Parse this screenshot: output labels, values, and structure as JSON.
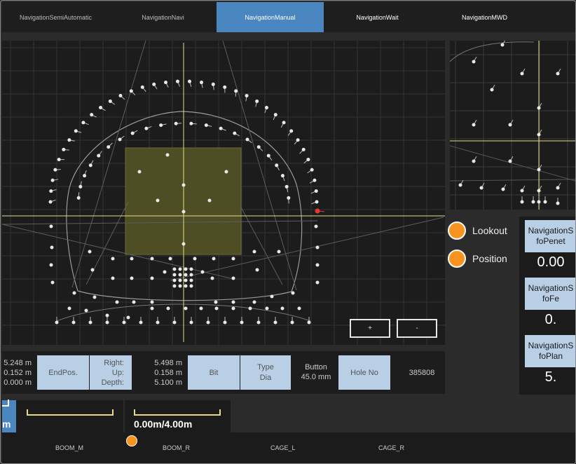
{
  "tabs": [
    {
      "label": "NavigationSemiAutomatic",
      "state": "normal"
    },
    {
      "label": "NavigationNavi",
      "state": "normal"
    },
    {
      "label": "NavigationManual",
      "state": "active"
    },
    {
      "label": "NavigationWait",
      "state": "light"
    },
    {
      "label": "NavigationMWD",
      "state": "light"
    }
  ],
  "zoom": {
    "plus": "+",
    "minus": "-"
  },
  "status": {
    "lookout": "Lookout",
    "position": "Position",
    "color": "#f7931e"
  },
  "nav_panel": {
    "items": [
      {
        "line1": "NavigationS",
        "line2": "foPenet",
        "value": "0.00"
      },
      {
        "line1": "NavigationS",
        "line2": "foFe",
        "value": "0."
      },
      {
        "line1": "NavigationS",
        "line2": "foPlan",
        "value": "5."
      }
    ]
  },
  "info": {
    "left_values": [
      "5.248 m",
      "0.152 m",
      "0.000 m"
    ],
    "endpos": "EndPos.",
    "axes": [
      "Right:",
      "Up:",
      "Depth:"
    ],
    "right_values": [
      "5.498 m",
      "0.158 m",
      "5.100 m"
    ],
    "bit": "Bit",
    "type_dia": [
      "Type",
      "Dia"
    ],
    "button": [
      "Button",
      "45.0 mm"
    ],
    "hole_no": "Hole No",
    "id": "385808"
  },
  "depth": {
    "left_unit": "m",
    "progress": "0.00m/4.00m"
  },
  "booms": [
    "BOOM_M",
    "BOOM_R",
    "CAGE_L",
    "CAGE_R"
  ],
  "colors": {
    "accent": "#4a86c0",
    "panel_label": "#b8cfe6",
    "crosshair": "#e6dc8a",
    "target": "#e23b2e"
  }
}
